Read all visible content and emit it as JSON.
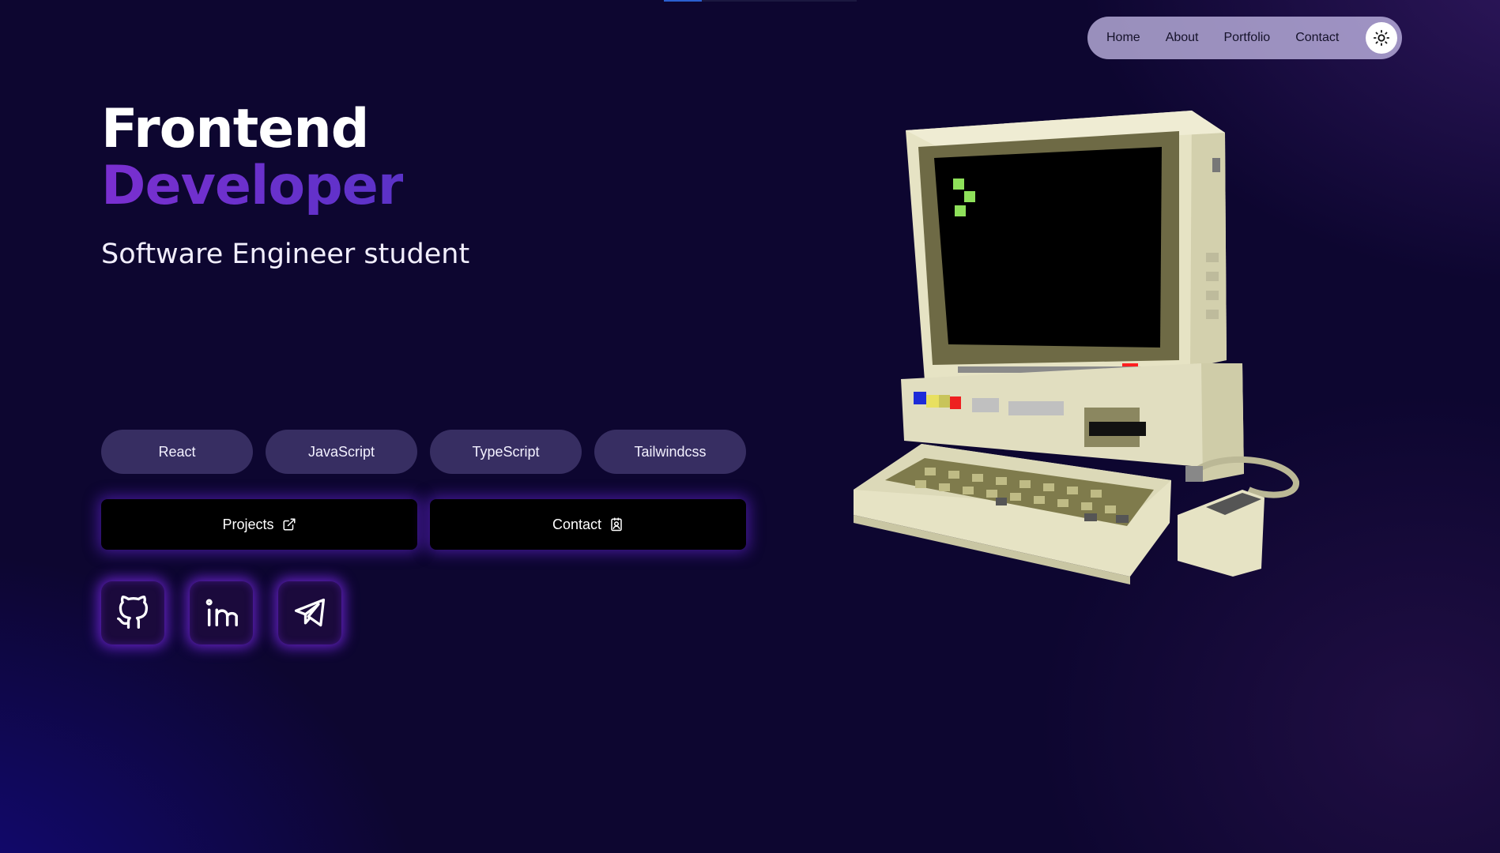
{
  "nav": {
    "links": [
      "Home",
      "About",
      "Portfolio",
      "Contact"
    ],
    "theme_toggle_icon": "sun-icon"
  },
  "hero": {
    "title_line1": "Frontend",
    "title_line2": "Developer",
    "subtitle": "Software Engineer student"
  },
  "skills": [
    "React",
    "JavaScript",
    "TypeScript",
    "Tailwindcss"
  ],
  "buttons": {
    "projects_label": "Projects",
    "projects_icon": "external-link-icon",
    "contact_label": "Contact",
    "contact_icon": "contact-card-icon"
  },
  "socials": [
    {
      "name": "GitHub",
      "icon": "github-icon"
    },
    {
      "name": "LinkedIn",
      "icon": "linkedin-icon"
    },
    {
      "name": "Telegram",
      "icon": "telegram-icon"
    }
  ],
  "colors": {
    "background": "#0d0630",
    "accent_purple": "#7a2fd0",
    "glow": "#6e28e6",
    "nav_bg": "#c8beeb"
  }
}
